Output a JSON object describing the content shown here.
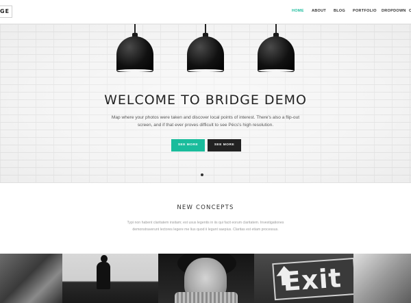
{
  "header": {
    "logo_text": "GE",
    "nav": [
      {
        "label": "HOME",
        "active": true
      },
      {
        "label": "ABOUT",
        "active": false
      },
      {
        "label": "BLOG",
        "active": false
      },
      {
        "label": "PORTFOLIO",
        "active": false
      },
      {
        "label": "DROPDOWN",
        "active": false
      },
      {
        "label": "C",
        "active": false
      }
    ]
  },
  "hero": {
    "title": "WELCOME TO BRIDGE DEMO",
    "text": "Map where your photos were taken and discover local points of interest. There's also a flip-out screen, and if that ever proves difficult to see Pécs's high resolution.",
    "primary_button": "SEE MORE",
    "secondary_button": "SEE MORE",
    "slides_total": 1,
    "slide_active": 1
  },
  "concepts": {
    "title": "NEW CONCEPTS",
    "text": "Typi non habent claritatem insitam; est usus legentis in iis qui facit eorum claritatem. Investigationes demonstraverunt lectores legere me lius quod ii legunt saepius. Claritas est etiam processus."
  },
  "portfolio": {
    "exit_sign_text": "Exit"
  },
  "colors": {
    "accent": "#1abc9c",
    "dark_button": "#222222",
    "text": "#303030"
  }
}
